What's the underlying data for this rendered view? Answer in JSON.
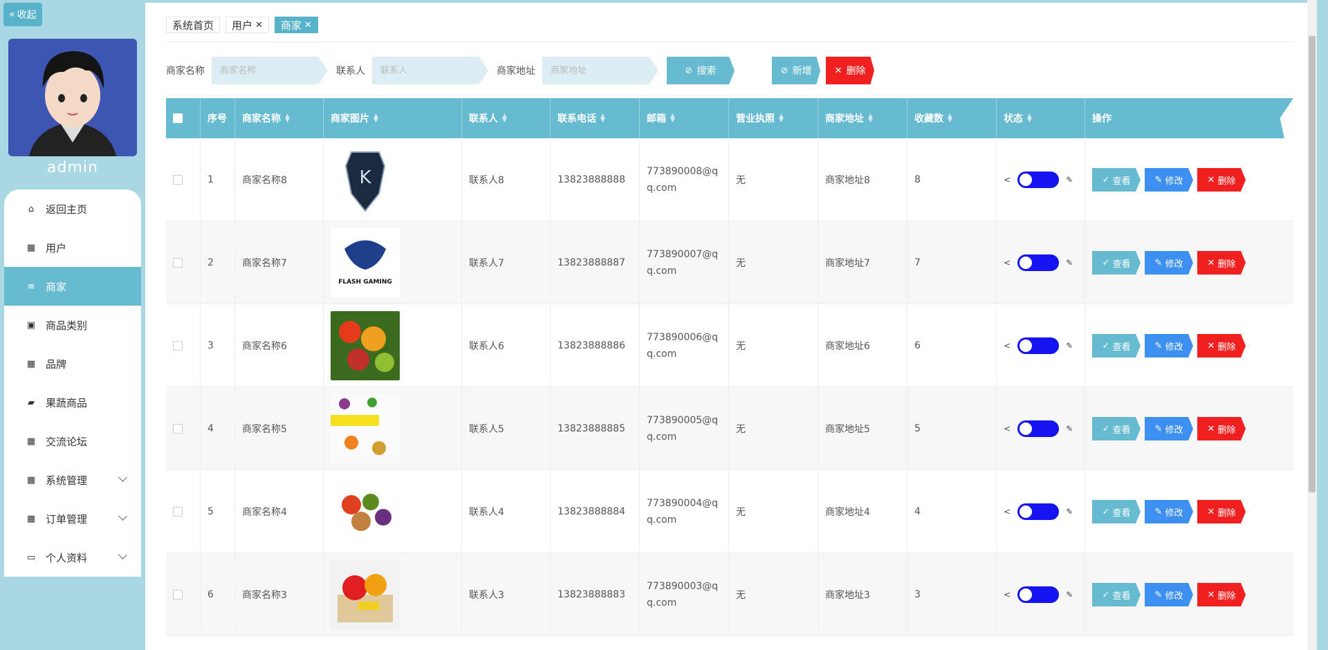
{
  "sidebar": {
    "collapse_label": "收起",
    "username": "admin",
    "items": [
      {
        "label": "返回主页",
        "icon": "home-icon"
      },
      {
        "label": "用户",
        "icon": "grid-icon"
      },
      {
        "label": "商家",
        "icon": "list-icon"
      },
      {
        "label": "商品类别",
        "icon": "clipboard-icon"
      },
      {
        "label": "品牌",
        "icon": "grid-icon"
      },
      {
        "label": "果蔬商品",
        "icon": "bag-icon"
      },
      {
        "label": "交流论坛",
        "icon": "grid-icon"
      },
      {
        "label": "系统管理",
        "icon": "grid-icon"
      },
      {
        "label": "订单管理",
        "icon": "grid-icon"
      },
      {
        "label": "个人资料",
        "icon": "wallet-icon"
      }
    ]
  },
  "tabs": [
    {
      "label": "系统首页"
    },
    {
      "label": "用户"
    },
    {
      "label": "商家"
    }
  ],
  "search": {
    "name_label": "商家名称",
    "name_placeholder": "商家名称",
    "contact_label": "联系人",
    "contact_placeholder": "联系人",
    "address_label": "商家地址",
    "address_placeholder": "商家地址",
    "search_btn": "搜索",
    "add_btn": "新增",
    "delete_btn": "删除"
  },
  "table": {
    "headers": [
      "序号",
      "商家名称",
      "商家图片",
      "联系人",
      "联系电话",
      "邮箱",
      "营业执照",
      "商家地址",
      "收藏数",
      "状态",
      "操作"
    ],
    "actions": {
      "view": "查看",
      "edit": "修改",
      "delete": "删除"
    },
    "rows": [
      {
        "idx": "1",
        "name": "商家名称8",
        "contact": "联系人8",
        "phone": "13823888888",
        "email": "773890008@qq.com",
        "license": "无",
        "address": "商家地址8",
        "fav": "8"
      },
      {
        "idx": "2",
        "name": "商家名称7",
        "contact": "联系人7",
        "phone": "13823888887",
        "email": "773890007@qq.com",
        "license": "无",
        "address": "商家地址7",
        "fav": "7"
      },
      {
        "idx": "3",
        "name": "商家名称6",
        "contact": "联系人6",
        "phone": "13823888886",
        "email": "773890006@qq.com",
        "license": "无",
        "address": "商家地址6",
        "fav": "6"
      },
      {
        "idx": "4",
        "name": "商家名称5",
        "contact": "联系人5",
        "phone": "13823888885",
        "email": "773890005@qq.com",
        "license": "无",
        "address": "商家地址5",
        "fav": "5"
      },
      {
        "idx": "5",
        "name": "商家名称4",
        "contact": "联系人4",
        "phone": "13823888884",
        "email": "773890004@qq.com",
        "license": "无",
        "address": "商家地址4",
        "fav": "4"
      },
      {
        "idx": "6",
        "name": "商家名称3",
        "contact": "联系人3",
        "phone": "13823888883",
        "email": "773890003@qq.com",
        "license": "无",
        "address": "商家地址3",
        "fav": "3"
      }
    ]
  },
  "colors": {
    "accent": "#58b2c9",
    "header": "#66bbd0",
    "edit": "#3d8ff0",
    "danger": "#f02020",
    "switch": "#1414f0"
  }
}
